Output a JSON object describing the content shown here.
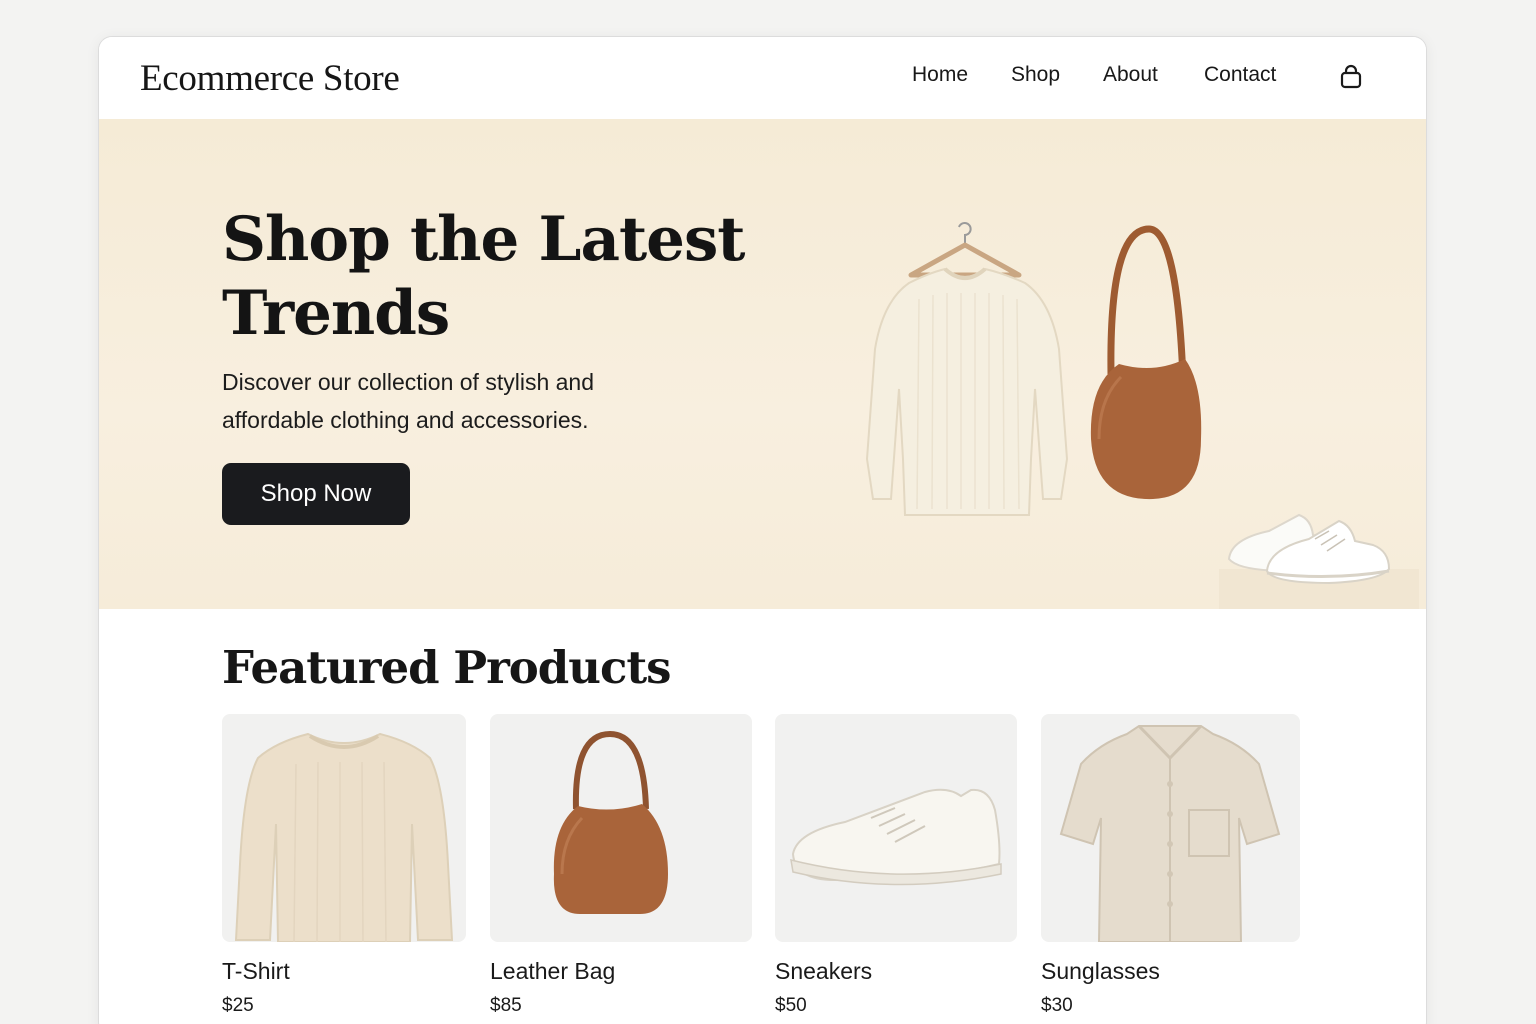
{
  "header": {
    "logo": "Ecommerce Store",
    "nav": [
      "Home",
      "Shop",
      "About",
      "Contact"
    ],
    "cart_icon": "shopping-bag-icon"
  },
  "hero": {
    "title_line1": "Shop the Latest",
    "title_line2": "Trends",
    "subtitle_line1": "Discover our collection of stylish and",
    "subtitle_line2": "affordable clothing and accessories.",
    "cta": "Shop Now",
    "image_icons": [
      "sweater-on-hanger-icon",
      "leather-shoulder-bag-icon",
      "white-sneakers-icon"
    ]
  },
  "featured": {
    "title": "Featured Products",
    "products": [
      {
        "name": "T-Shirt",
        "price": "$25",
        "icon": "sweater-icon"
      },
      {
        "name": "Leather Bag",
        "price": "$85",
        "icon": "leather-bag-icon"
      },
      {
        "name": "Sneakers",
        "price": "$50",
        "icon": "sneaker-icon"
      },
      {
        "name": "Sunglasses",
        "price": "$30",
        "icon": "shirt-icon"
      }
    ]
  },
  "colors": {
    "hero_bg": "#f6ecd9",
    "button_bg": "#1a1b1e",
    "leather": "#a9643a",
    "cream": "#f4ede0",
    "card_bg": "#f1f1f0"
  }
}
